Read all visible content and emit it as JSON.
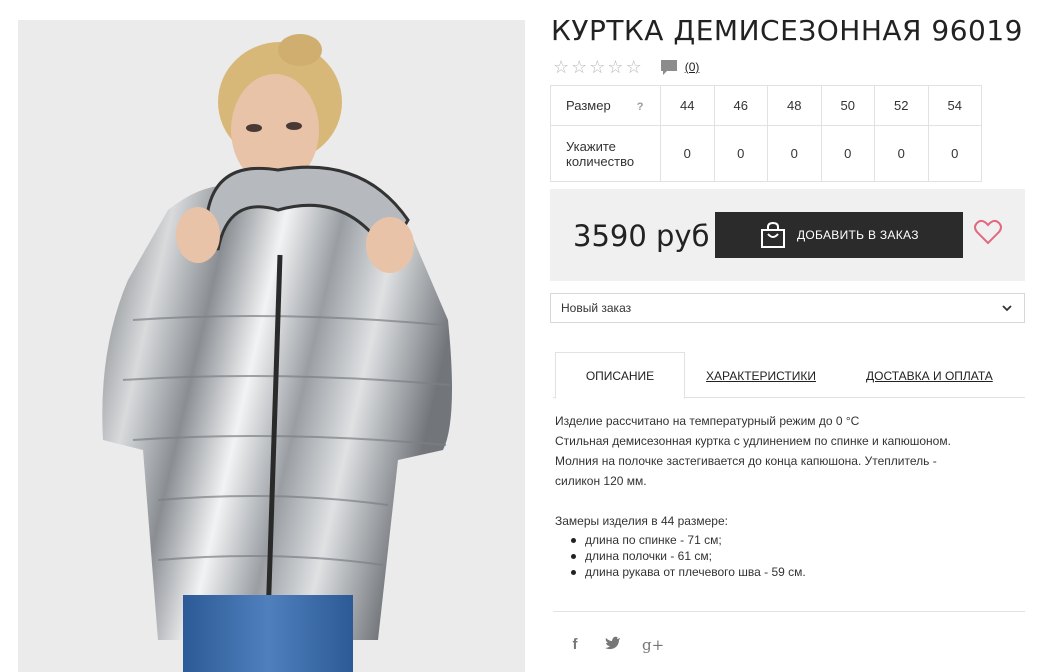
{
  "product": {
    "title": "КУРТКА ДЕМИСЕЗОННАЯ 96019",
    "review_count": "(0)",
    "price": "3590 руб",
    "add_button": "ДОБАВИТЬ В ЗАКАЗ",
    "order_select": "Новый заказ"
  },
  "sizes": {
    "size_label": "Размер",
    "help": "?",
    "qty_label_1": "Укажите",
    "qty_label_2": "количество",
    "values": [
      "44",
      "46",
      "48",
      "50",
      "52",
      "54"
    ],
    "quantities": [
      "0",
      "0",
      "0",
      "0",
      "0",
      "0"
    ]
  },
  "tabs": [
    "ОПИСАНИЕ",
    "ХАРАКТЕРИСТИКИ",
    "ДОСТАВКА И ОПЛАТА"
  ],
  "description": {
    "line1": "Изделие рассчитано на температурный режим до 0 °С",
    "line2": "Стильная демисезонная куртка с удлинением по спинке и капюшоном.",
    "line3": "Молния на полочке застегивается до конца капюшона. Утеплитель -",
    "line4": "силикон 120 мм.",
    "measure_title": "Замеры изделия в 44 размере:",
    "measures": [
      "длина по спинке - 71 см;",
      "длина полочки - 61 см;",
      "длина рукава от плечевого шва - 59 см."
    ]
  },
  "social": {
    "facebook": "f",
    "twitter": "t",
    "gplus": "g+"
  },
  "icons": [
    "star-icon",
    "comment-icon",
    "bag-icon",
    "heart-icon",
    "chevron-down-icon"
  ],
  "colors": {
    "button": "#2b2b2b",
    "heart": "#e06a7f",
    "panel": "#f0f0f0"
  }
}
